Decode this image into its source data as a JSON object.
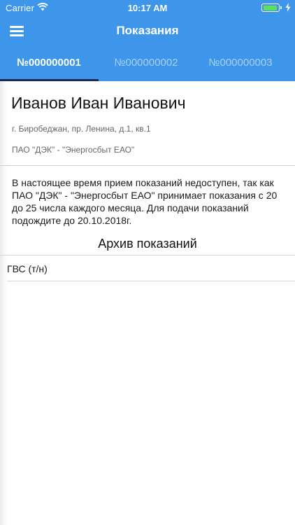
{
  "status_bar": {
    "carrier": "Carrier",
    "time": "10:17 AM",
    "battery_color": "#5ee05a"
  },
  "navbar": {
    "title": "Показания",
    "menu_icon": "hamburger-menu-icon",
    "background_color": "#3d96ea"
  },
  "tabs": [
    {
      "label": "№000000001",
      "active": true
    },
    {
      "label": "№000000002",
      "active": false
    },
    {
      "label": "№000000003",
      "active": false
    }
  ],
  "account": {
    "owner_name": "Иванов Иван Иванович",
    "address": "г. Биробеджан, пр. Ленина, д.1, кв.1",
    "supplier": "ПАО \"ДЭК\" - \"Энергосбыт ЕАО\""
  },
  "notice": "В настоящее время прием показаний недоступен, так как ПАО \"ДЭК\" - \"Энергосбыт ЕАО\" принимает показания с 20 до 25 числа каждого месяца. Для подачи показаний подождите до 20.10.2018г.",
  "archive": {
    "title": "Архив показаний",
    "items": [
      {
        "label": "ГВС (т/н)"
      }
    ]
  }
}
